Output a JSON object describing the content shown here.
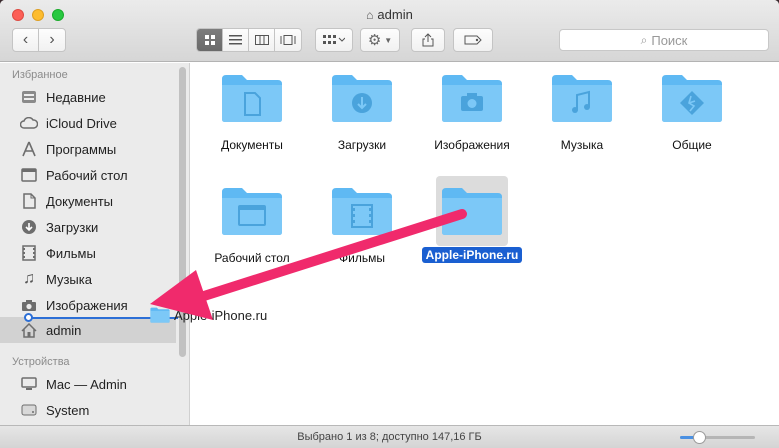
{
  "window": {
    "title": "admin"
  },
  "toolbar": {
    "search_placeholder": "Поиск"
  },
  "sidebar": {
    "favorites_header": "Избранное",
    "devices_header": "Устройства",
    "favorites": [
      {
        "label": "Недавние",
        "icon": "recents-icon"
      },
      {
        "label": "iCloud Drive",
        "icon": "cloud-icon"
      },
      {
        "label": "Программы",
        "icon": "applications-icon"
      },
      {
        "label": "Рабочий стол",
        "icon": "desktop-icon"
      },
      {
        "label": "Документы",
        "icon": "documents-icon"
      },
      {
        "label": "Загрузки",
        "icon": "downloads-icon"
      },
      {
        "label": "Фильмы",
        "icon": "movies-icon"
      },
      {
        "label": "Музыка",
        "icon": "music-icon"
      },
      {
        "label": "Изображения",
        "icon": "pictures-icon"
      },
      {
        "label": "admin",
        "icon": "home-icon"
      }
    ],
    "devices": [
      {
        "label": "Mac — Admin",
        "icon": "computer-icon"
      },
      {
        "label": "System",
        "icon": "disk-icon"
      }
    ]
  },
  "content": {
    "items": [
      {
        "label": "Документы",
        "glyph": "document"
      },
      {
        "label": "Загрузки",
        "glyph": "download"
      },
      {
        "label": "Изображения",
        "glyph": "camera"
      },
      {
        "label": "Музыка",
        "glyph": "music"
      },
      {
        "label": "Общие",
        "glyph": "public"
      },
      {
        "label": "Рабочий стол",
        "glyph": "desktop"
      },
      {
        "label": "Фильмы",
        "glyph": "film"
      },
      {
        "label": "Apple-iPhone.ru",
        "glyph": "none"
      }
    ]
  },
  "drag": {
    "label": "Apple-iPhone.ru"
  },
  "status": {
    "text": "Выбрано 1 из 8; доступно 147,16 ГБ",
    "zoom_fraction": 0.25
  },
  "colors": {
    "folder": "#5fb9f3",
    "selection": "#1a5fd1",
    "arrow": "#f02a6c"
  }
}
